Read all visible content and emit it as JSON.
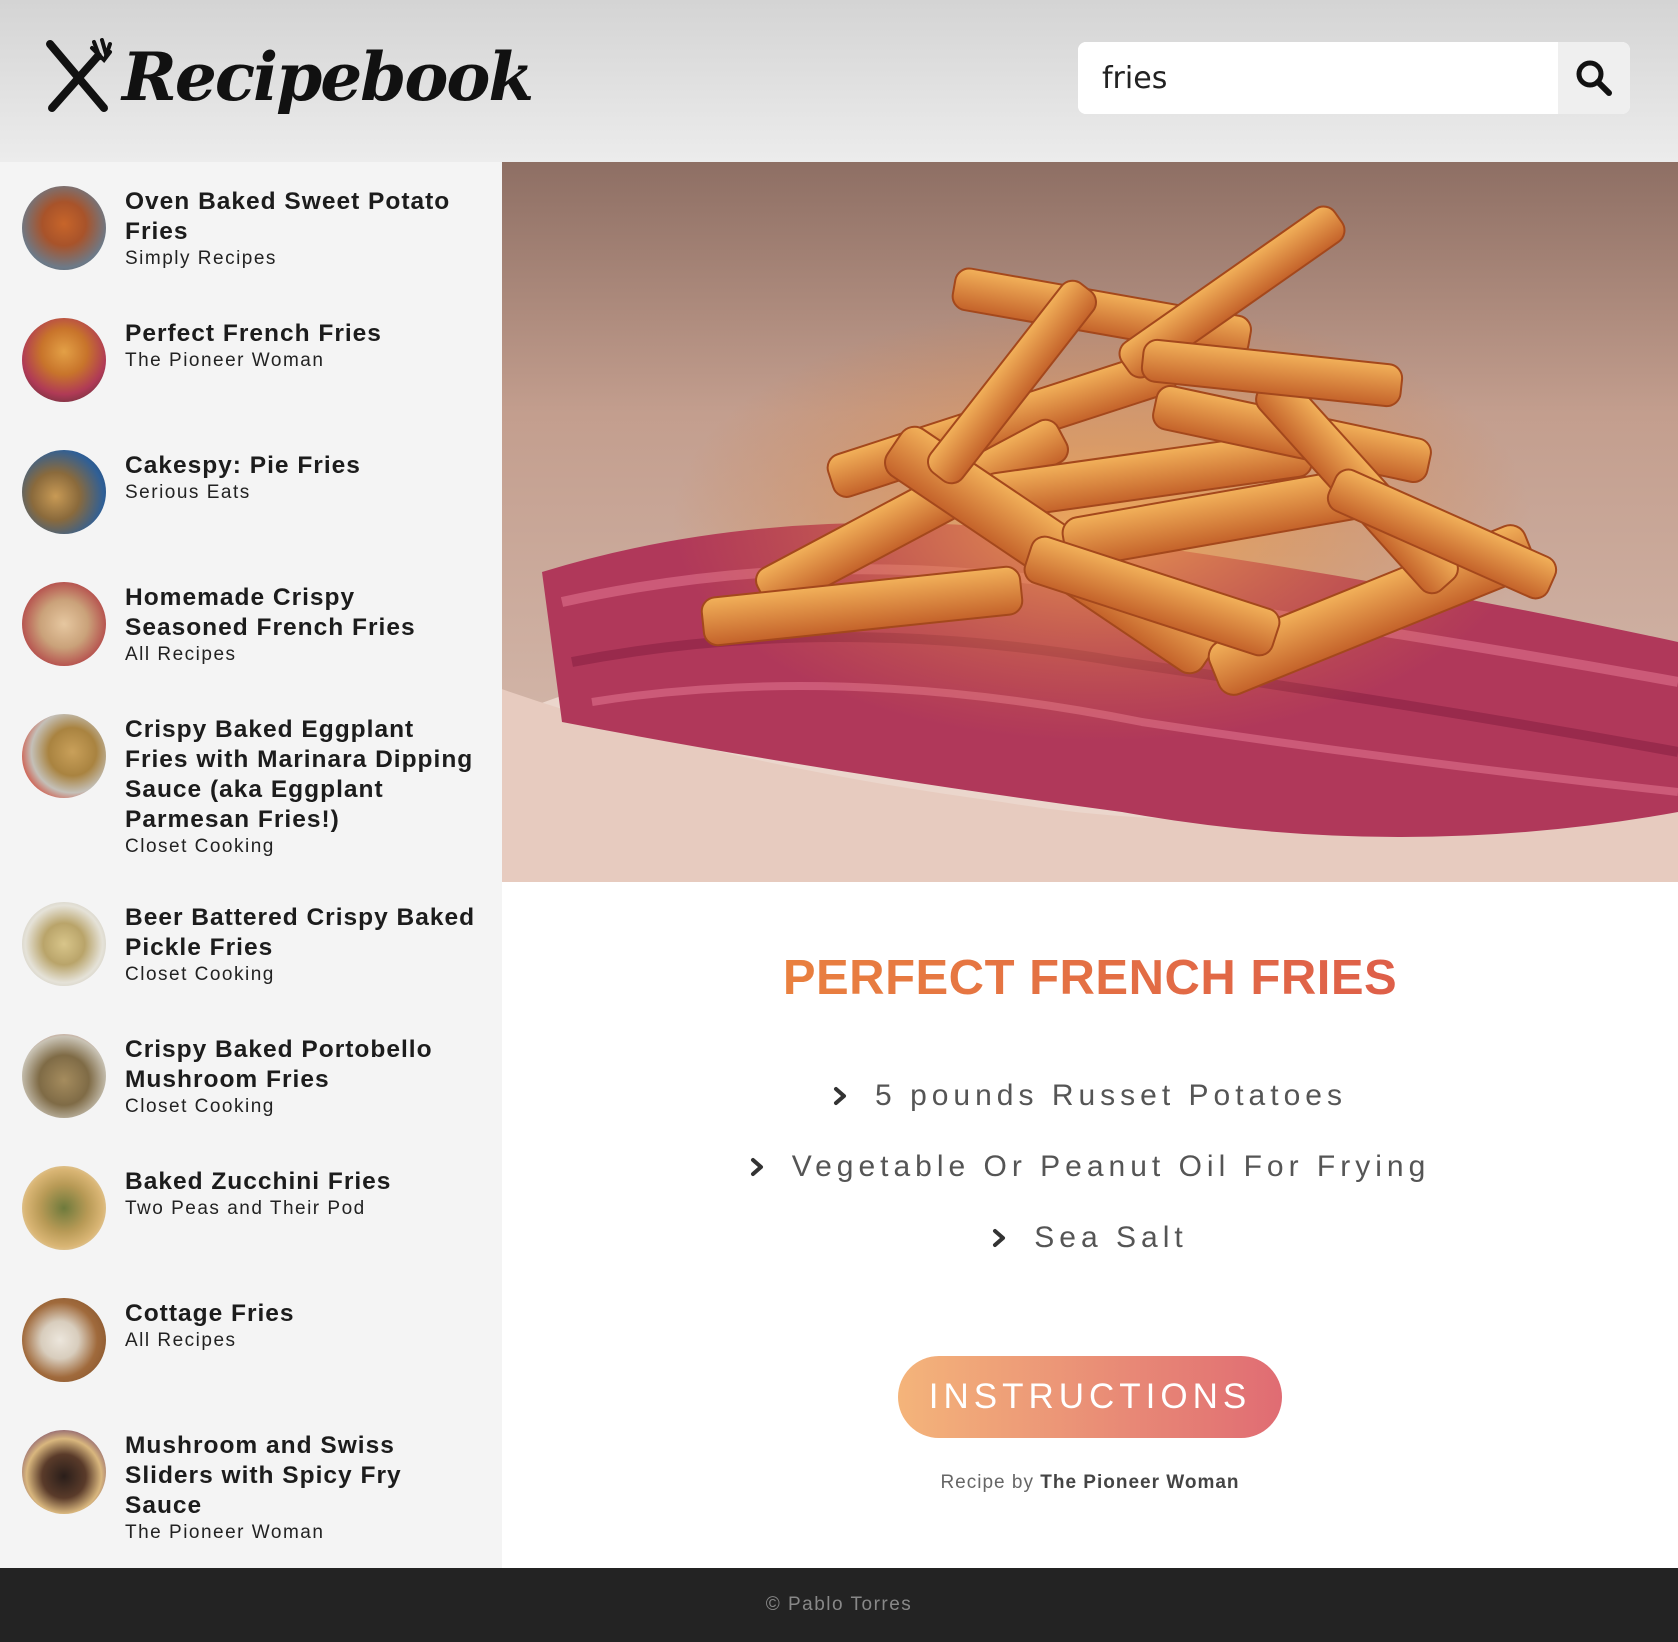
{
  "header": {
    "logo_text": "Recipebook",
    "search_value": "fries"
  },
  "sidebar": {
    "items": [
      {
        "title": "Oven Baked Sweet Potato Fries",
        "publisher": "Simply Recipes"
      },
      {
        "title": "Perfect French Fries",
        "publisher": "The Pioneer Woman"
      },
      {
        "title": "Cakespy: Pie Fries",
        "publisher": "Serious Eats"
      },
      {
        "title": "Homemade Crispy Seasoned French Fries",
        "publisher": "All Recipes"
      },
      {
        "title": "Crispy Baked Eggplant Fries with Marinara Dipping Sauce (aka Eggplant Parmesan Fries!)",
        "publisher": "Closet Cooking"
      },
      {
        "title": "Beer Battered Crispy Baked Pickle Fries",
        "publisher": "Closet Cooking"
      },
      {
        "title": "Crispy Baked Portobello Mushroom Fries",
        "publisher": "Closet Cooking"
      },
      {
        "title": "Baked Zucchini Fries",
        "publisher": "Two Peas and Their Pod"
      },
      {
        "title": "Cottage Fries",
        "publisher": "All Recipes"
      },
      {
        "title": "Mushroom and Swiss Sliders with Spicy Fry Sauce",
        "publisher": "The Pioneer Woman"
      }
    ]
  },
  "recipe": {
    "title": "PERFECT FRENCH FRIES",
    "ingredients": [
      "5 pounds Russet Potatoes",
      "Vegetable Or Peanut Oil For Frying",
      "Sea Salt"
    ],
    "instructions_label": "INSTRUCTIONS",
    "credit_prefix": "Recipe by",
    "credit_publisher": "The Pioneer Woman"
  },
  "footer": {
    "copyright": "© Pablo Torres"
  },
  "colors": {
    "title_gradient_start": "#ee8f3a",
    "title_gradient_end": "#d9504e",
    "button_gradient_start": "#f4b47a",
    "button_gradient_end": "#e06c73",
    "sidebar_bg": "#f4f4f4",
    "footer_bg": "#232323"
  },
  "icons": {
    "logo": "fork-knife-icon",
    "search": "search-icon",
    "ingredient_bullet": "chevron-right-icon"
  }
}
